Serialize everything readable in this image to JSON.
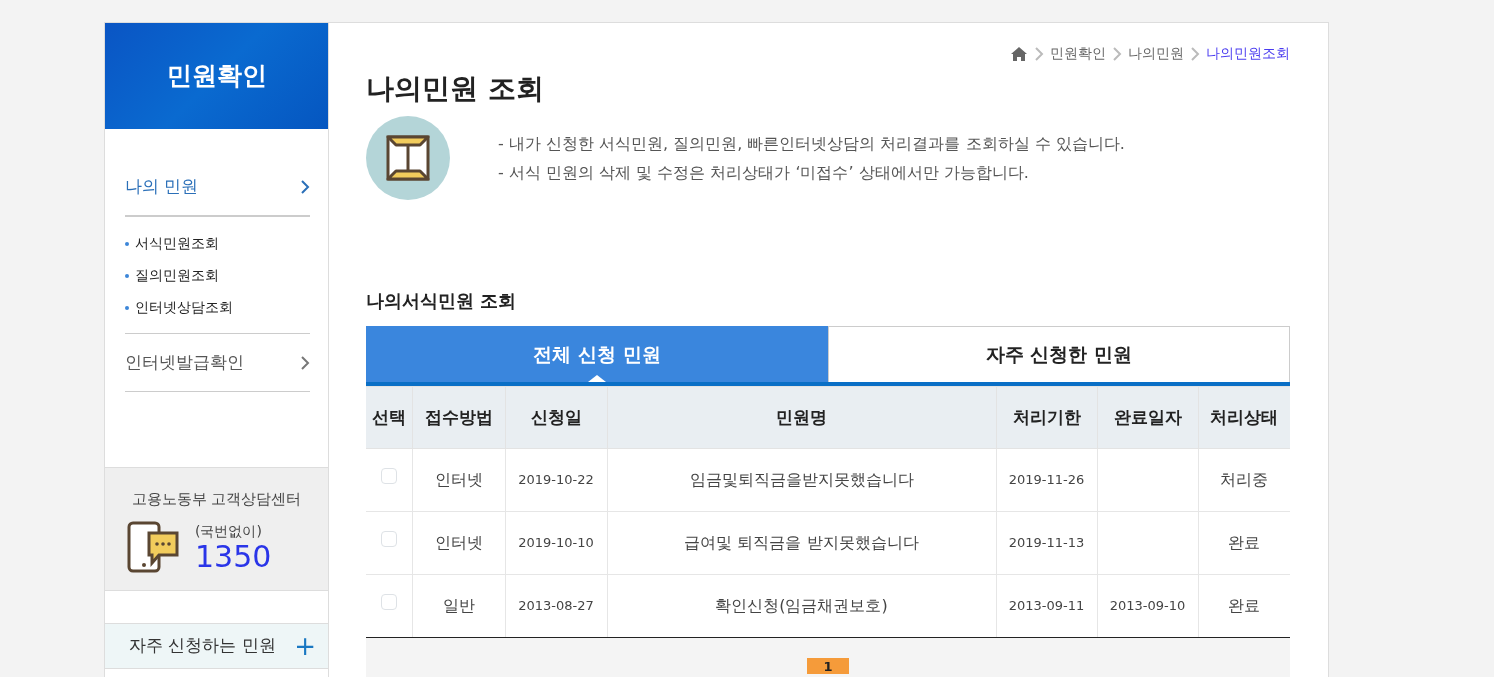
{
  "sidebar": {
    "title": "민원확인",
    "menu": [
      {
        "label": "나의 민원",
        "selected": true,
        "children": [
          {
            "label": "서식민원조회"
          },
          {
            "label": "질의민원조회"
          },
          {
            "label": "인터넷상담조회"
          }
        ]
      },
      {
        "label": "인터넷발급확인",
        "selected": false
      }
    ],
    "helpdesk": {
      "title": "고용노동부 고객상담센터",
      "note": "(국번없이)",
      "number": "1350"
    },
    "favorites": {
      "label": "자주 신청하는 민원",
      "toggle": "+"
    }
  },
  "breadcrumb": [
    "민원확인",
    "나의민원",
    "나의민원조회"
  ],
  "page_title": "나의민원 조회",
  "notices": [
    "- 내가 신청한 서식민원, 질의민원, 빠른인터넷상담의 처리결과를 조회하실 수 있습니다.",
    "- 서식 민원의 삭제 및 수정은 처리상태가 ‘미접수’ 상태에서만 가능합니다."
  ],
  "section_title": "나의서식민원 조회",
  "tabs": [
    {
      "label": "전체 신청 민원",
      "selected": true
    },
    {
      "label": "자주 신청한 민원",
      "selected": false
    }
  ],
  "table": {
    "columns": [
      "선택",
      "접수방법",
      "신청일",
      "민원명",
      "처리기한",
      "완료일자",
      "처리상태"
    ],
    "rows": [
      {
        "checked": false,
        "method": "인터넷",
        "applied": "2019-10-22",
        "name": "임금및퇴직금을받지못했습니다",
        "deadline": "2019-11-26",
        "completed": "",
        "status": "처리중"
      },
      {
        "checked": false,
        "method": "인터넷",
        "applied": "2019-10-10",
        "name": "급여및 퇴직금을 받지못했습니다",
        "deadline": "2019-11-13",
        "completed": "",
        "status": "완료"
      },
      {
        "checked": false,
        "method": "일반",
        "applied": "2013-08-27",
        "name": "확인신청(임금채권보호)",
        "deadline": "2013-09-11",
        "completed": "2013-09-10",
        "status": "완료"
      }
    ]
  },
  "pagination": [
    {
      "label": "1",
      "selected": true
    }
  ]
}
